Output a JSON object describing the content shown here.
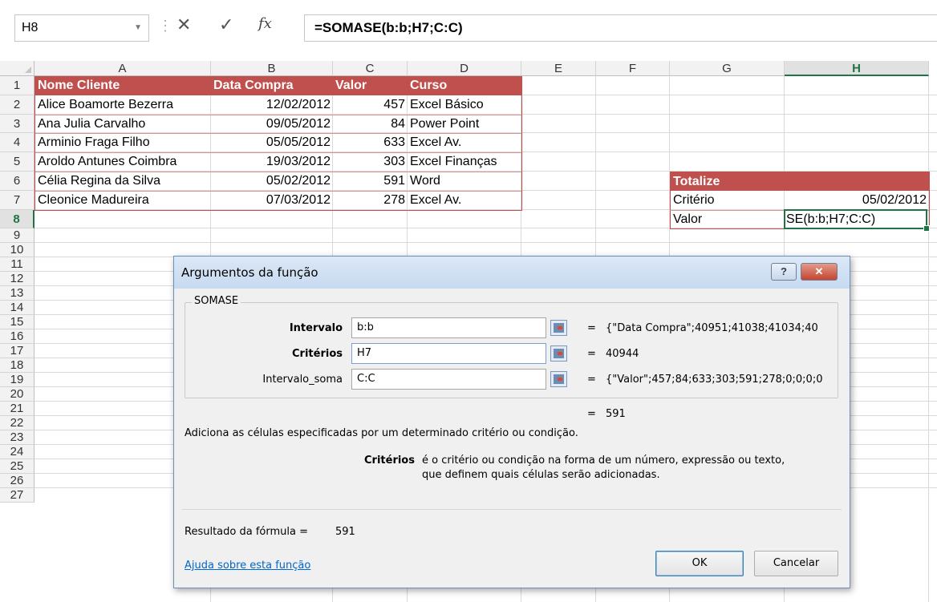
{
  "formula_bar": {
    "name_box": "H8",
    "cancel_symbol": "✕",
    "enter_symbol": "✓",
    "fx_label": "fx",
    "formula": "=SOMASE(b:b;H7;C:C)"
  },
  "columns": [
    "A",
    "B",
    "C",
    "D",
    "E",
    "F",
    "G",
    "H"
  ],
  "rows": [
    "1",
    "2",
    "3",
    "4",
    "5",
    "6",
    "7",
    "8",
    "9",
    "10",
    "11",
    "12",
    "13",
    "14",
    "15",
    "16",
    "17",
    "18",
    "19",
    "20",
    "21",
    "22",
    "23",
    "24",
    "25",
    "26",
    "27"
  ],
  "table": {
    "headers": [
      "Nome Cliente",
      "Data Compra",
      "Valor",
      "Curso"
    ],
    "rows": [
      [
        "Alice Boamorte Bezerra",
        "12/02/2012",
        "457",
        "Excel Básico"
      ],
      [
        "Ana Julia Carvalho",
        "09/05/2012",
        "84",
        "Power Point"
      ],
      [
        "Arminio Fraga Filho",
        "05/05/2012",
        "633",
        "Excel Av."
      ],
      [
        "Aroldo Antunes Coimbra",
        "19/03/2012",
        "303",
        "Excel Finanças"
      ],
      [
        "Célia Regina da Silva",
        "05/02/2012",
        "591",
        "Word"
      ],
      [
        "Cleonice Madureira",
        "07/03/2012",
        "278",
        "Excel Av."
      ]
    ]
  },
  "totals": {
    "title": "Totalize",
    "criterio_label": "Critério",
    "criterio_value": "05/02/2012",
    "valor_label": "Valor",
    "valor_edit": "SE(b:b;H7;C:C)"
  },
  "dialog": {
    "title": "Argumentos da função",
    "help_symbol": "?",
    "close_symbol": "✕",
    "function_name": "SOMASE",
    "args": [
      {
        "label": "Intervalo",
        "value": "b:b",
        "result": "{\"Data Compra\";40951;41038;41034;40"
      },
      {
        "label": "Critérios",
        "value": "H7",
        "result": "40944"
      },
      {
        "label": "Intervalo_soma",
        "value": "C:C",
        "result": "{\"Valor\";457;84;633;303;591;278;0;0;0;0"
      }
    ],
    "eq": "=",
    "function_result": "591",
    "description": "Adiciona as células especificadas por um determinado critério ou condição.",
    "arg_help_name": "Critérios",
    "arg_help_text_1": "é o critério ou condição na forma de um número, expressão ou texto,",
    "arg_help_text_2": "que definem quais células serão adicionadas.",
    "result_label": "Resultado da fórmula =",
    "result_value": "591",
    "help_link": "Ajuda sobre esta função",
    "ok_label": "OK",
    "cancel_label": "Cancelar"
  }
}
